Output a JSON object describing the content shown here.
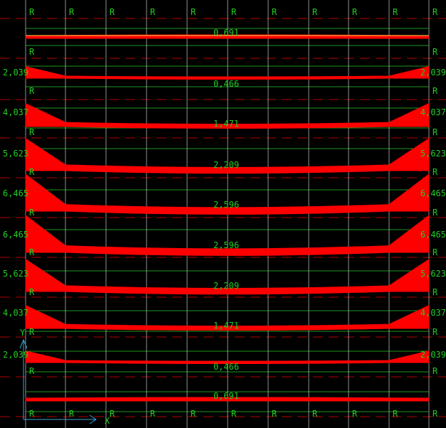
{
  "colors": {
    "background": "#000000",
    "grid_line": "#b4b4b4",
    "guide_line": "#22b422",
    "moment_fill": "#ff0000",
    "label_text": "#22cc22",
    "dash_line": "#b40000",
    "axis": "#3aa6d8"
  },
  "support_label": "R",
  "axis_labels": {
    "y": "Y",
    "x": "X"
  },
  "strips": [
    {
      "center": "0,691",
      "end": ""
    },
    {
      "center": "0,466",
      "end": "2,039"
    },
    {
      "center": "1,471",
      "end": "4,037"
    },
    {
      "center": "2,209",
      "end": "5,623"
    },
    {
      "center": "2,596",
      "end": "6,465"
    },
    {
      "center": "2,596",
      "end": "6,465"
    },
    {
      "center": "2,209",
      "end": "5,623"
    },
    {
      "center": "1,471",
      "end": "4,037"
    },
    {
      "center": "0,466",
      "end": "2,039"
    },
    {
      "center": "0,691",
      "end": ""
    }
  ]
}
